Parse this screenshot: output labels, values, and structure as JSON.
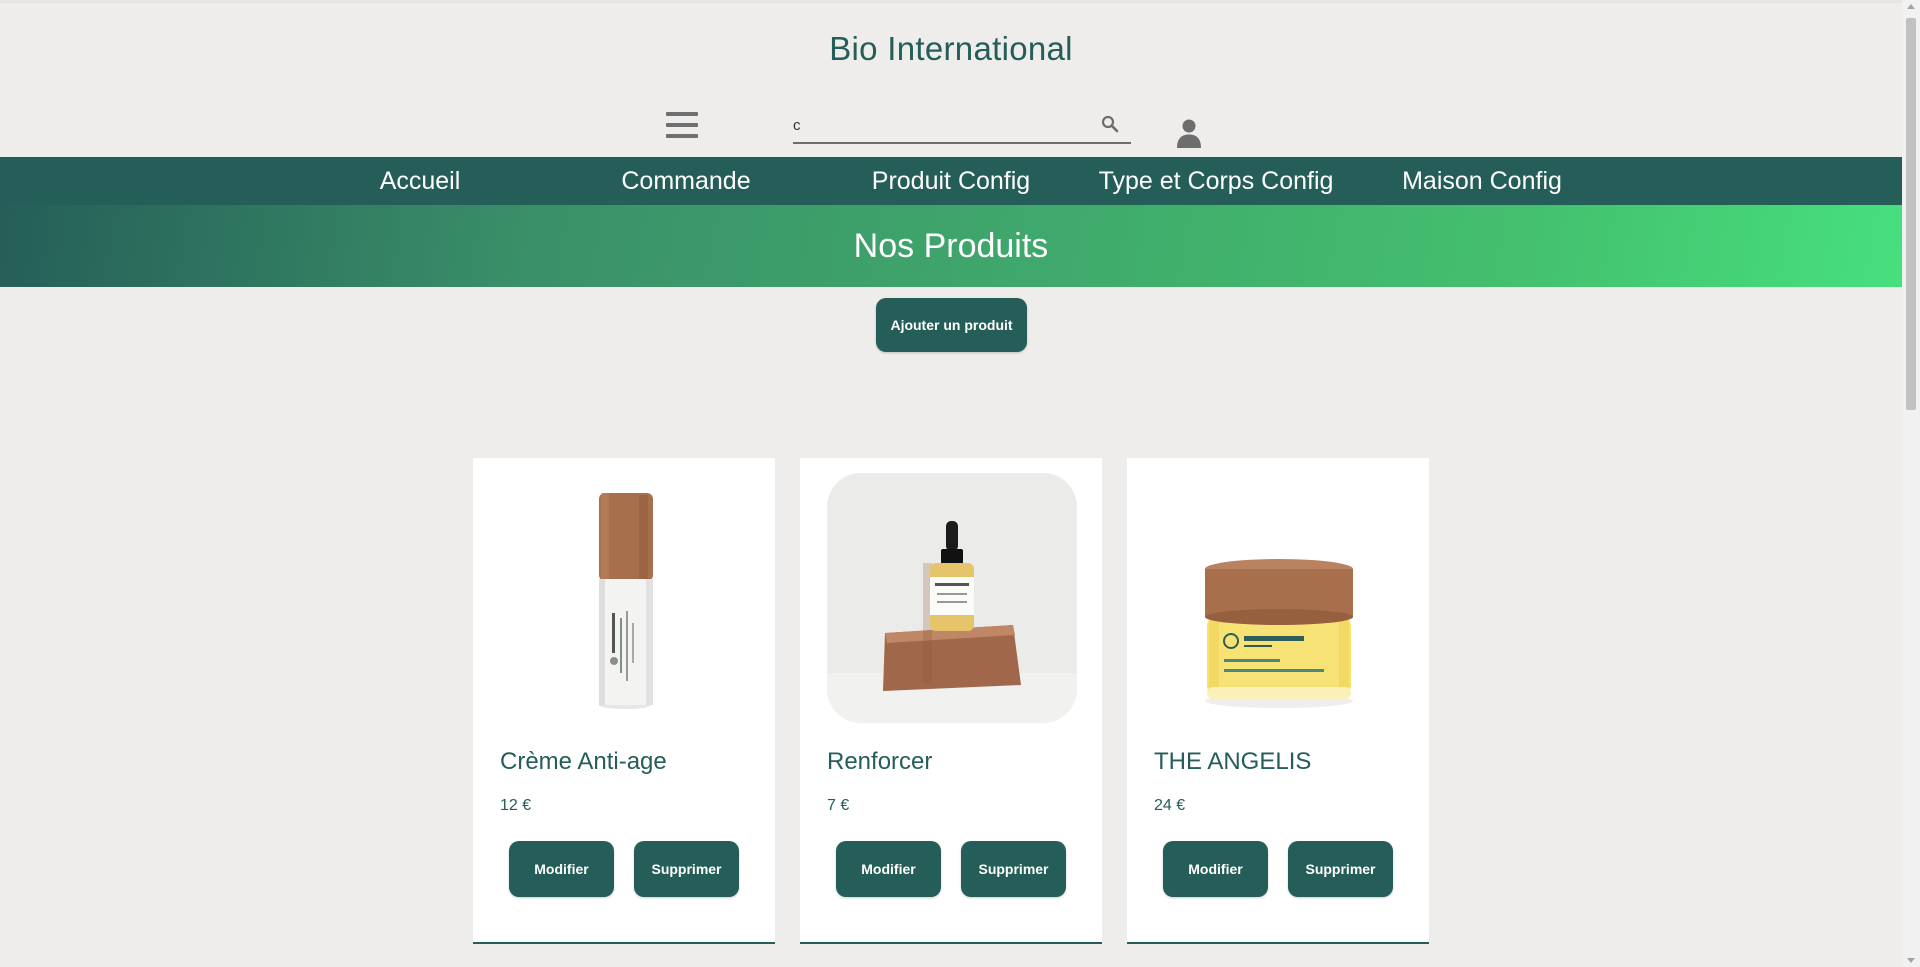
{
  "header": {
    "site_title": "Bio International",
    "search": {
      "value": "c",
      "placeholder": ""
    }
  },
  "nav": {
    "items": [
      {
        "label": "Accueil"
      },
      {
        "label": "Commande"
      },
      {
        "label": "Produit Config"
      },
      {
        "label": "Type et Corps Config"
      },
      {
        "label": "Maison Config"
      }
    ]
  },
  "hero": {
    "title": "Nos Produits"
  },
  "actions": {
    "add_product_label": "Ajouter un produit"
  },
  "products": [
    {
      "name": "Crème Anti-age",
      "price": "12 €",
      "edit_label": "Modifier",
      "delete_label": "Supprimer"
    },
    {
      "name": "Renforcer",
      "price": "7 €",
      "edit_label": "Modifier",
      "delete_label": "Supprimer"
    },
    {
      "name": "THE ANGELIS",
      "price": "24 €",
      "edit_label": "Modifier",
      "delete_label": "Supprimer"
    }
  ],
  "colors": {
    "primary": "#255e58",
    "background": "#eeedeb",
    "hero_gradient_end": "#46e07d",
    "card_background": "#ffffff"
  },
  "icons": {
    "menu": "hamburger-menu-icon",
    "search": "search-icon",
    "user": "user-icon"
  }
}
